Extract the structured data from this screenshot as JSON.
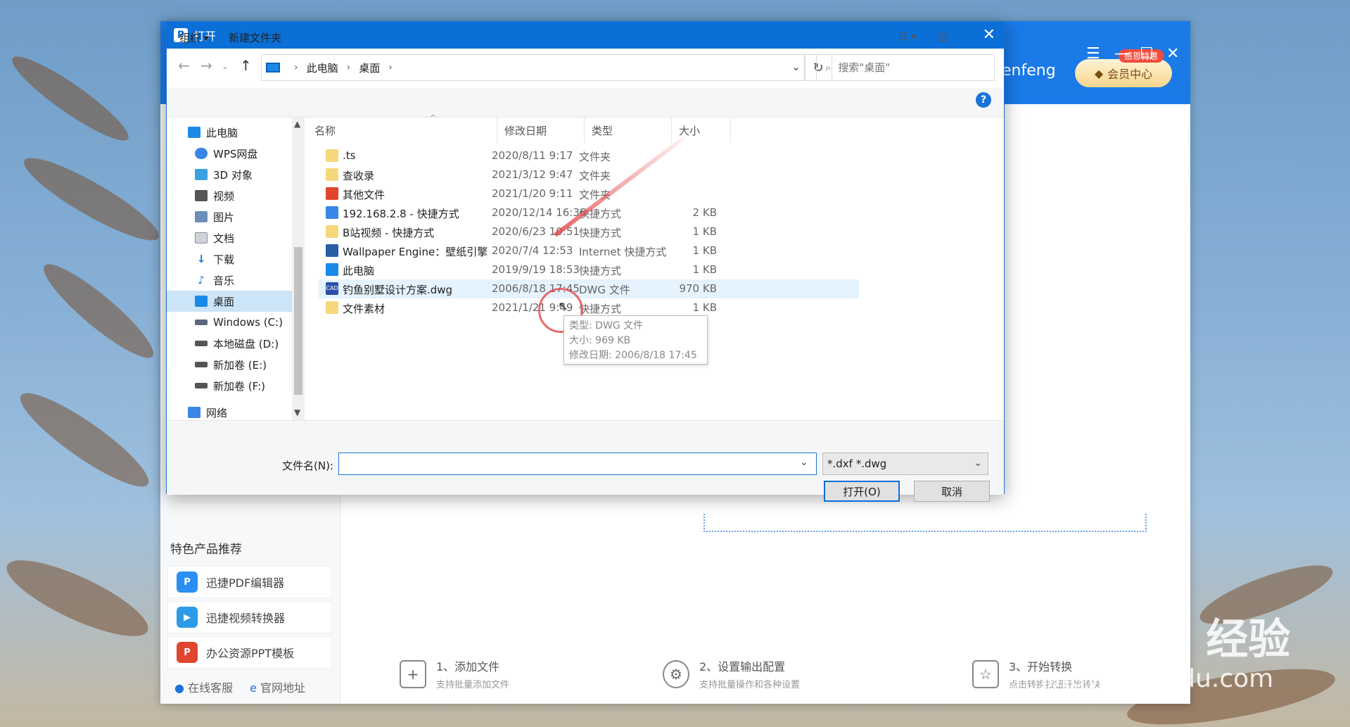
{
  "app": {
    "user_name": "enfeng",
    "vip_label": "会员中心",
    "vip_badge": "感恩特惠",
    "featured_title": "特色产品推荐",
    "products": [
      {
        "label": "迅捷PDF编辑器",
        "color": "#2a8ff2",
        "icon": "pdf-editor-icon"
      },
      {
        "label": "迅捷视频转换器",
        "color": "#2b9be8",
        "icon": "video-converter-icon"
      },
      {
        "label": "办公资源PPT模板",
        "color": "#e0452e",
        "icon": "ppt-template-icon"
      }
    ],
    "footer": {
      "service": "在线客服",
      "website": "官网地址"
    },
    "steps": [
      {
        "title": "1、添加文件",
        "desc": "支持批量添加文件"
      },
      {
        "title": "2、设置输出配置",
        "desc": "支持批量操作和各种设置"
      },
      {
        "title": "3、开始转换",
        "desc": "点击转换按钮开始转换"
      }
    ]
  },
  "dialog": {
    "title": "打开",
    "breadcrumb": [
      "此电脑",
      "桌面"
    ],
    "search_placeholder": "搜索\"桌面\"",
    "toolbar": {
      "organize": "组织",
      "new_folder": "新建文件夹"
    },
    "tree": [
      {
        "label": "此电脑",
        "icon": "computer-icon",
        "color": "#1a8ae8"
      },
      {
        "label": "WPS网盘",
        "icon": "cloud-icon",
        "color": "#3a86e8"
      },
      {
        "label": "3D 对象",
        "icon": "cube-icon",
        "color": "#3aa0e0"
      },
      {
        "label": "视频",
        "icon": "video-icon",
        "color": "#555555"
      },
      {
        "label": "图片",
        "icon": "picture-icon",
        "color": "#6a8fb8"
      },
      {
        "label": "文档",
        "icon": "document-icon",
        "color": "#8a8f96"
      },
      {
        "label": "下载",
        "icon": "download-icon",
        "color": "#1a73d8"
      },
      {
        "label": "音乐",
        "icon": "music-icon",
        "color": "#1a73d8"
      },
      {
        "label": "桌面",
        "icon": "desktop-icon",
        "color": "#1a8ae8"
      },
      {
        "label": "Windows (C:)",
        "icon": "drive-icon",
        "color": "#5a6a7a"
      },
      {
        "label": "本地磁盘 (D:)",
        "icon": "drive-icon",
        "color": "#555555"
      },
      {
        "label": "新加卷 (E:)",
        "icon": "drive-icon",
        "color": "#555555"
      },
      {
        "label": "新加卷 (F:)",
        "icon": "drive-icon",
        "color": "#555555"
      },
      {
        "label": "网络",
        "icon": "network-icon",
        "color": "#3a86e8"
      }
    ],
    "columns": {
      "name": "名称",
      "date": "修改日期",
      "type": "类型",
      "size": "大小"
    },
    "files": [
      {
        "name": ".ts",
        "date": "2020/8/11 9:17",
        "type": "文件夹",
        "size": "",
        "color": "#f5d87a"
      },
      {
        "name": "查收录",
        "date": "2021/3/12 9:47",
        "type": "文件夹",
        "size": "",
        "color": "#f5d87a"
      },
      {
        "name": "其他文件",
        "date": "2021/1/20 9:11",
        "type": "文件夹",
        "size": "",
        "color": "#e0452e"
      },
      {
        "name": "192.168.2.8 - 快捷方式",
        "date": "2020/12/14 16:36",
        "type": "快捷方式",
        "size": "2 KB",
        "color": "#3a86e8"
      },
      {
        "name": "B站视频 - 快捷方式",
        "date": "2020/6/23 10:51",
        "type": "快捷方式",
        "size": "1 KB",
        "color": "#f5d87a"
      },
      {
        "name": "Wallpaper Engine：壁纸引擎",
        "date": "2020/7/4 12:53",
        "type": "Internet 快捷方式",
        "size": "1 KB",
        "color": "#2a5fa8"
      },
      {
        "name": "此电脑",
        "date": "2019/9/19 18:53",
        "type": "快捷方式",
        "size": "1 KB",
        "color": "#1a8ae8"
      },
      {
        "name": "钓鱼别墅设计方案.dwg",
        "date": "2006/8/18 17:45",
        "type": "DWG 文件",
        "size": "970 KB",
        "color": "#2a4fa8"
      },
      {
        "name": "文件素材",
        "date": "2021/1/21 9:49",
        "type": "快捷方式",
        "size": "1 KB",
        "color": "#f5d87a"
      }
    ],
    "tooltip": {
      "type": "类型: DWG 文件",
      "size": "大小: 969 KB",
      "modified": "修改日期: 2006/8/18 17:45"
    },
    "filename_label": "文件名(N):",
    "filename_value": "",
    "filter": "*.dxf *.dwg",
    "open_button": "打开(O)",
    "cancel_button": "取消"
  },
  "watermark": {
    "brand": "Bai du 经验",
    "url": "jingyan.baidu.com"
  }
}
